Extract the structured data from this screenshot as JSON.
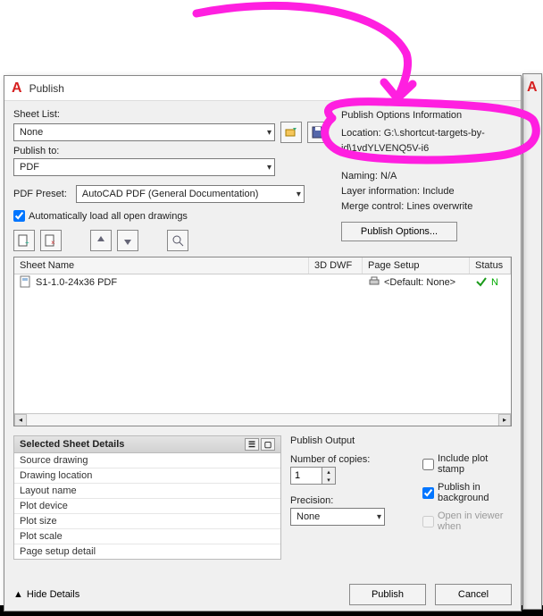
{
  "dialog": {
    "title": "Publish",
    "sheet_list_label": "Sheet List:",
    "sheet_list_value": "None",
    "publish_to_label": "Publish to:",
    "publish_to_value": "PDF",
    "pdf_preset_label": "PDF Preset:",
    "pdf_preset_value": "AutoCAD PDF (General Documentation)",
    "auto_load_label": "Automatically load all open drawings"
  },
  "options_info": {
    "heading": "Publish Options Information",
    "location_label": "Location:",
    "location_value": "G:\\.shortcut-targets-by-id\\1vdYLVENQ5V-i6",
    "filetype_hint": "",
    "naming_label": "Naming:",
    "naming_value": "N/A",
    "layer_label": "Layer information:",
    "layer_value": "Include",
    "merge_label": "Merge control:",
    "merge_value": "Lines overwrite",
    "button": "Publish Options..."
  },
  "table": {
    "cols": {
      "c1": "Sheet Name",
      "c2": "3D DWF",
      "c3": "Page Setup",
      "c4": "Status"
    },
    "rows": [
      {
        "sheet": "S1-1.0-24x36 PDF",
        "dwf": "",
        "page_setup": "<Default: None>",
        "status": "N"
      }
    ]
  },
  "details": {
    "heading": "Selected Sheet Details",
    "rows": [
      "Source drawing",
      "Drawing location",
      "Layout name",
      "Plot device",
      "Plot size",
      "Plot scale",
      "Page setup detail"
    ]
  },
  "output": {
    "heading": "Publish Output",
    "copies_label": "Number of copies:",
    "copies_value": "1",
    "precision_label": "Precision:",
    "precision_value": "None",
    "include_stamp": "Include plot stamp",
    "publish_bg": "Publish in background",
    "open_viewer": "Open in viewer when"
  },
  "footer": {
    "hide": "Hide Details",
    "publish": "Publish",
    "cancel": "Cancel"
  }
}
